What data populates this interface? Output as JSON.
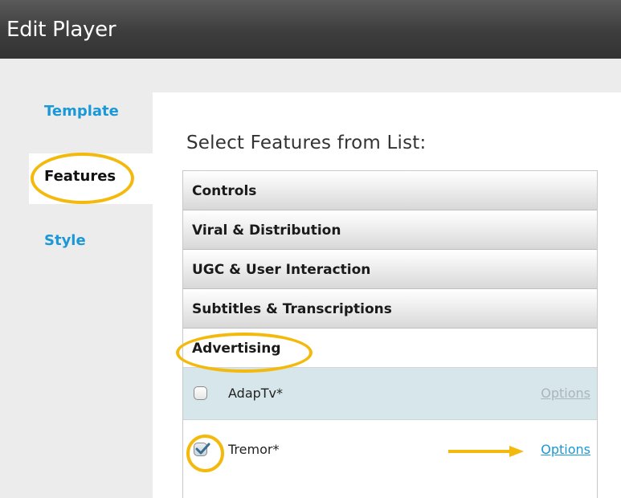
{
  "window": {
    "title": "Edit Player"
  },
  "sidebar": {
    "items": [
      {
        "label": "Template",
        "selected": false
      },
      {
        "label": "Features",
        "selected": true
      },
      {
        "label": "Style",
        "selected": false
      }
    ]
  },
  "main": {
    "heading": "Select Features from List:",
    "categories": [
      {
        "label": "Controls",
        "expanded": false
      },
      {
        "label": "Viral & Distribution",
        "expanded": false
      },
      {
        "label": "UGC & User Interaction",
        "expanded": false
      },
      {
        "label": "Subtitles & Transcriptions",
        "expanded": false
      },
      {
        "label": "Advertising",
        "expanded": true
      }
    ],
    "features": [
      {
        "name": "AdapTv*",
        "checked": false,
        "options_label": "Options",
        "options_enabled": false
      },
      {
        "name": "Tremor*",
        "checked": true,
        "options_label": "Options",
        "options_enabled": true
      }
    ]
  },
  "colors": {
    "accent": "#1b98d6",
    "annotation": "#f3b90c",
    "titlebar": "#3d3d3d",
    "highlight_row": "#d6e6ea"
  },
  "icons": [
    "checkbox-icon",
    "checkmark-icon",
    "arrow-right-icon"
  ]
}
